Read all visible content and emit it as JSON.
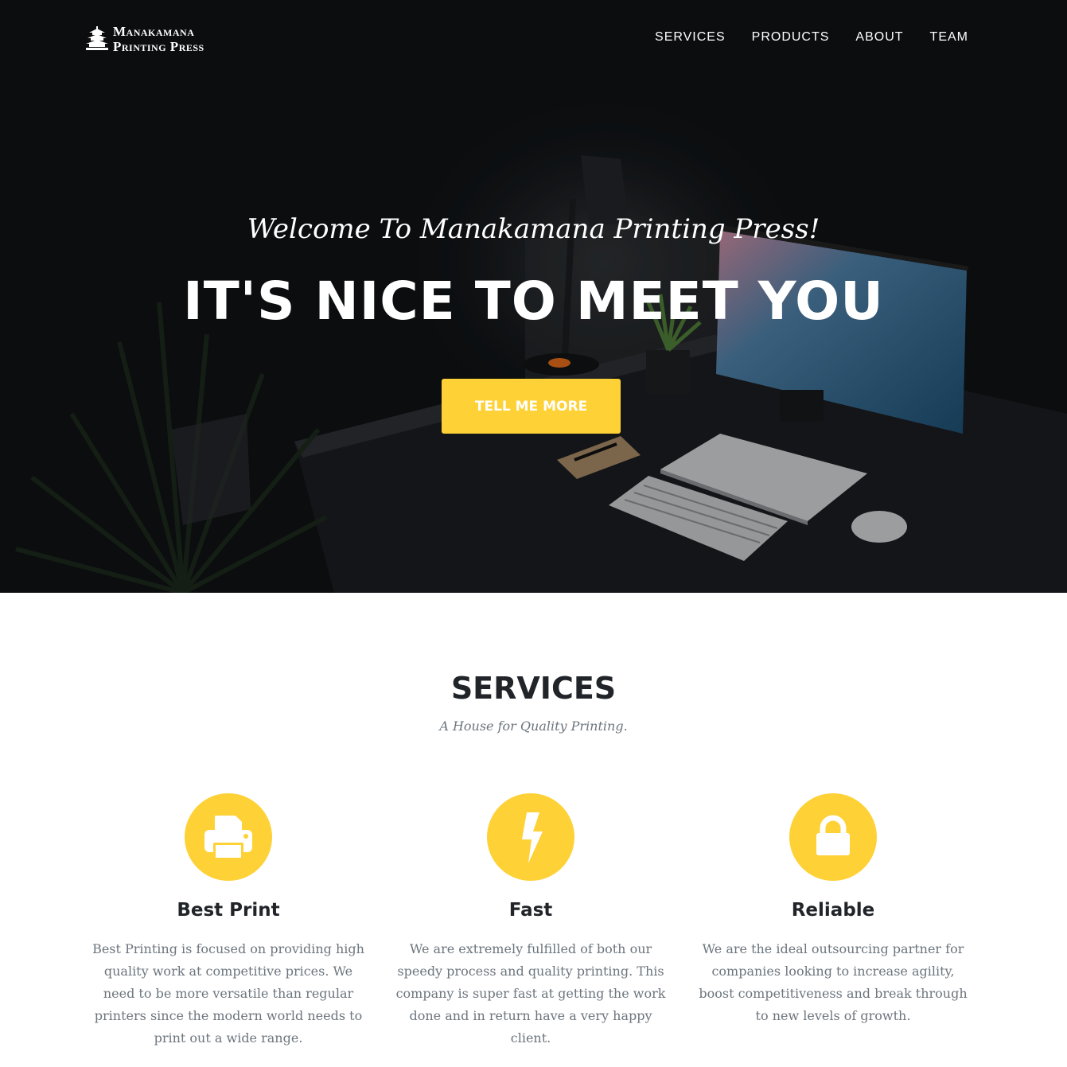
{
  "brand": {
    "line1": "Manakamana",
    "line2": "Printing Press"
  },
  "nav": {
    "items": [
      {
        "label": "SERVICES"
      },
      {
        "label": "PRODUCTS"
      },
      {
        "label": "ABOUT"
      },
      {
        "label": "TEAM"
      }
    ]
  },
  "hero": {
    "subheading": "Welcome To Manakamana Printing Press!",
    "heading": "IT'S NICE TO MEET YOU",
    "button_label": "TELL ME MORE"
  },
  "services": {
    "title": "SERVICES",
    "subtitle": "A House for Quality Printing.",
    "items": [
      {
        "icon": "printer-icon",
        "title": "Best Print",
        "text": "Best Printing is focused on providing high quality work at competitive prices. We need to be more versatile than regular printers since the modern world needs to print out a wide range."
      },
      {
        "icon": "lightning-icon",
        "title": "Fast",
        "text": "We are extremely fulfilled of both our speedy process and quality printing. This company is super fast at getting the work done and in return have a very happy client."
      },
      {
        "icon": "lock-icon",
        "title": "Reliable",
        "text": "We are the ideal outsourcing partner for companies looking to increase agility, boost competitiveness and break through to new levels of growth."
      }
    ]
  },
  "colors": {
    "accent": "#fed136",
    "hero_bg": "#0e1114",
    "heading": "#212529",
    "muted": "#6c757d"
  }
}
